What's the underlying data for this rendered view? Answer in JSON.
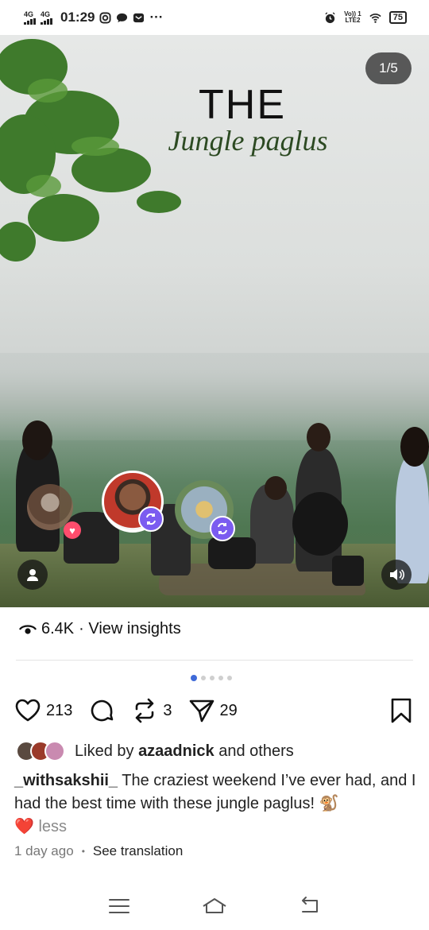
{
  "status_bar": {
    "net1": "4G",
    "net2": "4G",
    "time": "01:29",
    "more": "···",
    "volte_line1": "Vo)) 1",
    "volte_line2": "LTE2",
    "battery": "75"
  },
  "post": {
    "slide_counter": "1/5",
    "image_title": "THE",
    "image_subtitle": "Jungle paglus",
    "views": "6.4K",
    "view_insights": "· View insights",
    "likes": "213",
    "reposts": "3",
    "shares": "29",
    "liked_by_prefix": "Liked by",
    "liked_by_user": "azaadnick",
    "liked_by_suffix": "and others",
    "username": "_withsakshii_",
    "caption_text": " The craziest weekend I’ve ever had, and I had the best time with these jungle paglus! 🐒",
    "caption_heart": "❤️",
    "less": "less",
    "time_ago": "1 day ago",
    "separator": "•",
    "see_translation": "See translation"
  },
  "colors": {
    "accent_dot": "#3f6ad8",
    "repost_badge": "#7b5cf0",
    "heart_badge": "#ff4d6d",
    "subtitle_green": "#2c4a22"
  }
}
